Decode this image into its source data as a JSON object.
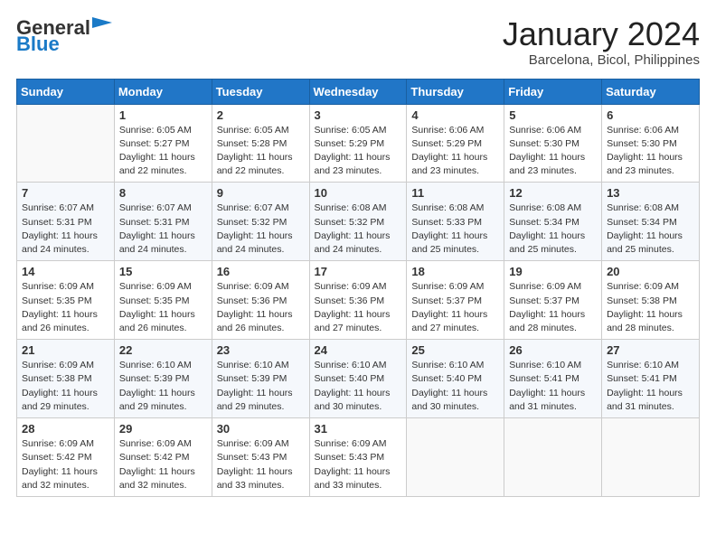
{
  "header": {
    "logo_general": "General",
    "logo_blue": "Blue",
    "month": "January 2024",
    "location": "Barcelona, Bicol, Philippines"
  },
  "days_of_week": [
    "Sunday",
    "Monday",
    "Tuesday",
    "Wednesday",
    "Thursday",
    "Friday",
    "Saturday"
  ],
  "weeks": [
    [
      {
        "day": "",
        "info": ""
      },
      {
        "day": "1",
        "info": "Sunrise: 6:05 AM\nSunset: 5:27 PM\nDaylight: 11 hours\nand 22 minutes."
      },
      {
        "day": "2",
        "info": "Sunrise: 6:05 AM\nSunset: 5:28 PM\nDaylight: 11 hours\nand 22 minutes."
      },
      {
        "day": "3",
        "info": "Sunrise: 6:05 AM\nSunset: 5:29 PM\nDaylight: 11 hours\nand 23 minutes."
      },
      {
        "day": "4",
        "info": "Sunrise: 6:06 AM\nSunset: 5:29 PM\nDaylight: 11 hours\nand 23 minutes."
      },
      {
        "day": "5",
        "info": "Sunrise: 6:06 AM\nSunset: 5:30 PM\nDaylight: 11 hours\nand 23 minutes."
      },
      {
        "day": "6",
        "info": "Sunrise: 6:06 AM\nSunset: 5:30 PM\nDaylight: 11 hours\nand 23 minutes."
      }
    ],
    [
      {
        "day": "7",
        "info": "Sunrise: 6:07 AM\nSunset: 5:31 PM\nDaylight: 11 hours\nand 24 minutes."
      },
      {
        "day": "8",
        "info": "Sunrise: 6:07 AM\nSunset: 5:31 PM\nDaylight: 11 hours\nand 24 minutes."
      },
      {
        "day": "9",
        "info": "Sunrise: 6:07 AM\nSunset: 5:32 PM\nDaylight: 11 hours\nand 24 minutes."
      },
      {
        "day": "10",
        "info": "Sunrise: 6:08 AM\nSunset: 5:32 PM\nDaylight: 11 hours\nand 24 minutes."
      },
      {
        "day": "11",
        "info": "Sunrise: 6:08 AM\nSunset: 5:33 PM\nDaylight: 11 hours\nand 25 minutes."
      },
      {
        "day": "12",
        "info": "Sunrise: 6:08 AM\nSunset: 5:34 PM\nDaylight: 11 hours\nand 25 minutes."
      },
      {
        "day": "13",
        "info": "Sunrise: 6:08 AM\nSunset: 5:34 PM\nDaylight: 11 hours\nand 25 minutes."
      }
    ],
    [
      {
        "day": "14",
        "info": "Sunrise: 6:09 AM\nSunset: 5:35 PM\nDaylight: 11 hours\nand 26 minutes."
      },
      {
        "day": "15",
        "info": "Sunrise: 6:09 AM\nSunset: 5:35 PM\nDaylight: 11 hours\nand 26 minutes."
      },
      {
        "day": "16",
        "info": "Sunrise: 6:09 AM\nSunset: 5:36 PM\nDaylight: 11 hours\nand 26 minutes."
      },
      {
        "day": "17",
        "info": "Sunrise: 6:09 AM\nSunset: 5:36 PM\nDaylight: 11 hours\nand 27 minutes."
      },
      {
        "day": "18",
        "info": "Sunrise: 6:09 AM\nSunset: 5:37 PM\nDaylight: 11 hours\nand 27 minutes."
      },
      {
        "day": "19",
        "info": "Sunrise: 6:09 AM\nSunset: 5:37 PM\nDaylight: 11 hours\nand 28 minutes."
      },
      {
        "day": "20",
        "info": "Sunrise: 6:09 AM\nSunset: 5:38 PM\nDaylight: 11 hours\nand 28 minutes."
      }
    ],
    [
      {
        "day": "21",
        "info": "Sunrise: 6:09 AM\nSunset: 5:38 PM\nDaylight: 11 hours\nand 29 minutes."
      },
      {
        "day": "22",
        "info": "Sunrise: 6:10 AM\nSunset: 5:39 PM\nDaylight: 11 hours\nand 29 minutes."
      },
      {
        "day": "23",
        "info": "Sunrise: 6:10 AM\nSunset: 5:39 PM\nDaylight: 11 hours\nand 29 minutes."
      },
      {
        "day": "24",
        "info": "Sunrise: 6:10 AM\nSunset: 5:40 PM\nDaylight: 11 hours\nand 30 minutes."
      },
      {
        "day": "25",
        "info": "Sunrise: 6:10 AM\nSunset: 5:40 PM\nDaylight: 11 hours\nand 30 minutes."
      },
      {
        "day": "26",
        "info": "Sunrise: 6:10 AM\nSunset: 5:41 PM\nDaylight: 11 hours\nand 31 minutes."
      },
      {
        "day": "27",
        "info": "Sunrise: 6:10 AM\nSunset: 5:41 PM\nDaylight: 11 hours\nand 31 minutes."
      }
    ],
    [
      {
        "day": "28",
        "info": "Sunrise: 6:09 AM\nSunset: 5:42 PM\nDaylight: 11 hours\nand 32 minutes."
      },
      {
        "day": "29",
        "info": "Sunrise: 6:09 AM\nSunset: 5:42 PM\nDaylight: 11 hours\nand 32 minutes."
      },
      {
        "day": "30",
        "info": "Sunrise: 6:09 AM\nSunset: 5:43 PM\nDaylight: 11 hours\nand 33 minutes."
      },
      {
        "day": "31",
        "info": "Sunrise: 6:09 AM\nSunset: 5:43 PM\nDaylight: 11 hours\nand 33 minutes."
      },
      {
        "day": "",
        "info": ""
      },
      {
        "day": "",
        "info": ""
      },
      {
        "day": "",
        "info": ""
      }
    ]
  ]
}
